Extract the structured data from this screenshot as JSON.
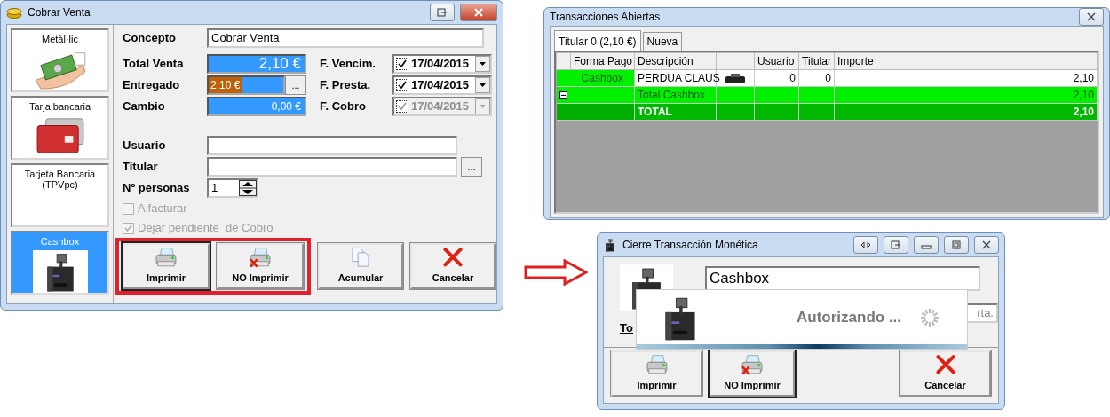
{
  "cobrar_venta": {
    "title": "Cobrar Venta",
    "payment_methods": [
      {
        "label": "Metàl·lic",
        "kind": "cash",
        "selected": false
      },
      {
        "label": "Tarja bancaria",
        "kind": "card",
        "selected": false
      },
      {
        "label": "Tarjeta Bancaria (TPVpc)",
        "kind": "none",
        "selected": false
      },
      {
        "label": "Cashbox",
        "kind": "cashbox",
        "selected": true
      }
    ],
    "concepto": {
      "label": "Concepto",
      "value": "Cobrar Venta"
    },
    "amounts": [
      {
        "label": "Total Venta",
        "value": "2,10 €",
        "kind": "total"
      },
      {
        "label": "Entregado",
        "value": "2,10 €",
        "kind": "given",
        "picker": "..."
      },
      {
        "label": "Cambio",
        "value": "0,00 €",
        "kind": "change"
      }
    ],
    "dates": [
      {
        "label": "F. Vencim.",
        "value": "17/04/2015",
        "checked": true,
        "disabled": false
      },
      {
        "label": "F. Presta.",
        "value": "17/04/2015",
        "checked": true,
        "disabled": false
      },
      {
        "label": "F. Cobro",
        "value": "17/04/2015",
        "checked": true,
        "disabled": true
      }
    ],
    "usuario": {
      "label": "Usuario"
    },
    "titular": {
      "label": "Titular",
      "picker": "..."
    },
    "personas": {
      "label": "Nº personas",
      "value": "1"
    },
    "options": [
      {
        "label": "A facturar",
        "checked": false,
        "disabled": true
      },
      {
        "label": "Dejar pendiente  de Cobro",
        "checked": true,
        "disabled": true
      }
    ],
    "buttons": [
      {
        "label": "Imprimir",
        "kind": "print",
        "focused": true,
        "highlighted": true
      },
      {
        "label": "NO Imprimir",
        "kind": "noprint",
        "focused": false,
        "highlighted": true
      },
      {
        "label": "Acumular",
        "kind": "accumulate",
        "focused": false,
        "highlighted": false
      },
      {
        "label": "Cancelar",
        "kind": "cancel",
        "focused": false,
        "highlighted": false
      }
    ]
  },
  "transacciones": {
    "title": "Transacciones Abiertas",
    "tabs": [
      {
        "label": "Titular 0 (2,10 €)",
        "selected": true
      },
      {
        "label": "Nueva",
        "selected": false
      }
    ],
    "columns": [
      {
        "label": "Forma Pago",
        "kind": "text"
      },
      {
        "label": "Descripción",
        "kind": "text"
      },
      {
        "kind": "device"
      },
      {
        "label": "Usuario",
        "kind": "text"
      },
      {
        "label": "Titular",
        "kind": "text"
      },
      {
        "label": "Importe",
        "kind": "text"
      }
    ],
    "rows": [
      {
        "kind": "item",
        "forma_pago": "Cashbox",
        "descripcion": "PERDUA CLAUS",
        "usuario": "0",
        "titular": "0",
        "importe": "2,10"
      },
      {
        "kind": "subtotal",
        "expanded": true,
        "descripcion": "Total Cashbox",
        "importe": "2,10"
      },
      {
        "kind": "total",
        "descripcion": "TOTAL",
        "importe": "2,10"
      }
    ]
  },
  "cierre": {
    "title": "Cierre Transacción Monética",
    "method": "Cashbox",
    "label": "To",
    "field": "rta.",
    "buttons": [
      {
        "label": "Imprimir",
        "kind": "print",
        "focused": false
      },
      {
        "label": "NO Imprimir",
        "kind": "noprint",
        "focused": true
      },
      {
        "label": "Cancelar",
        "kind": "cancel",
        "focused": false
      }
    ],
    "progress": {
      "message": "Autorizando ..."
    }
  }
}
